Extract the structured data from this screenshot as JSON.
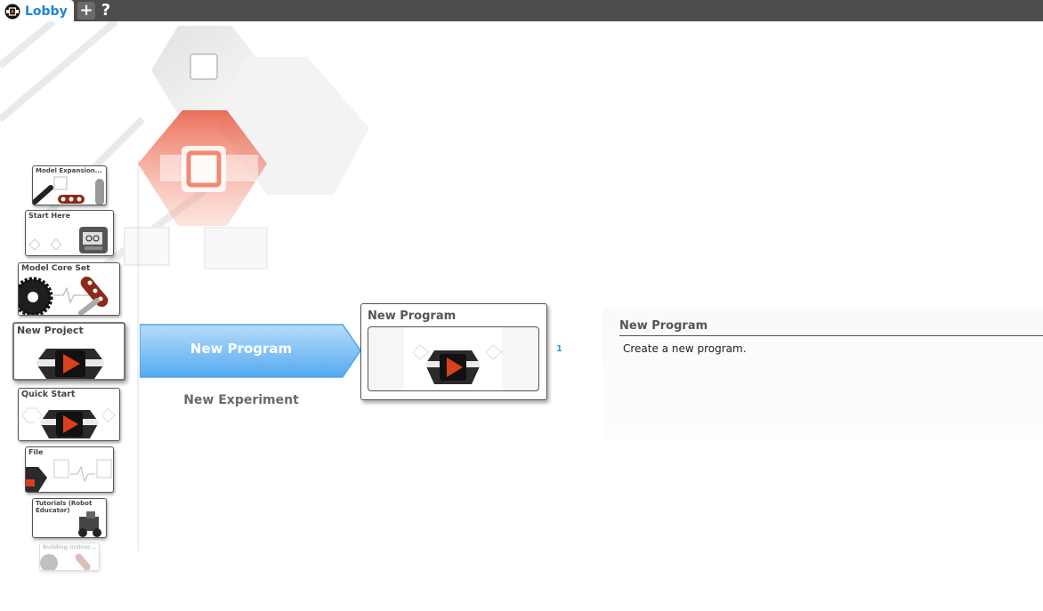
{
  "tabs": {
    "lobby_label": "Lobby",
    "add_label": "+",
    "help_label": "?"
  },
  "carousel": {
    "items": [
      {
        "label": "Model Expansion..."
      },
      {
        "label": "Start Here"
      },
      {
        "label": "Model Core Set"
      },
      {
        "label": "New Project"
      },
      {
        "label": "Quick Start"
      },
      {
        "label": "File"
      },
      {
        "label": "Tutorials (Robot Educator)"
      },
      {
        "label": "Building Instruc..."
      }
    ]
  },
  "selection": {
    "current": "New Program",
    "next": "New Experiment"
  },
  "program_card": {
    "title": "New Program",
    "count": "1"
  },
  "description": {
    "title": "New Program",
    "text": "Create a new program."
  },
  "colors": {
    "accent_blue": "#1c85d6",
    "band_blue": "#79bff5",
    "logo_red": "#d9401c",
    "count_blue": "#2e9fcf"
  }
}
